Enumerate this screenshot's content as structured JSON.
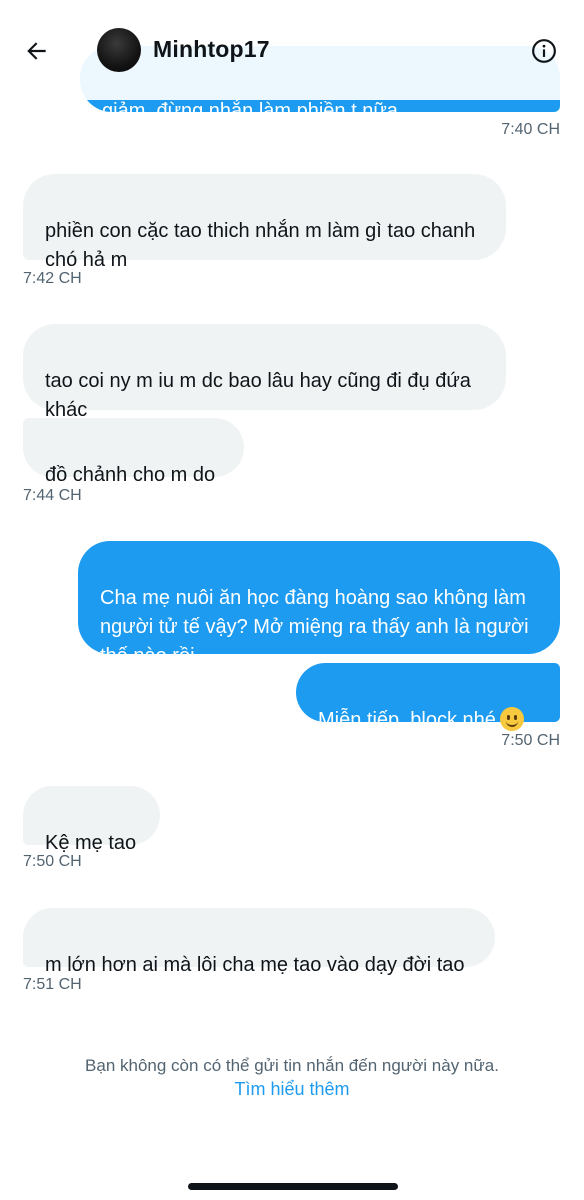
{
  "header": {
    "contact_name": "Minhtop17",
    "back_icon": "arrow-left-icon",
    "info_icon": "info-circle-icon"
  },
  "messages": [
    {
      "from": "me",
      "text": "giảm, đừng nhắn làm phiền t nữa",
      "time": "7:40 CH"
    },
    {
      "from": "them",
      "text": "phiền con cặc tao thich nhắn m làm gì tao chanh chó hả m",
      "time": "7:42 CH"
    },
    {
      "from": "them",
      "text": "tao coi ny m iu m dc bao lâu hay cũng đi đụ đứa khác"
    },
    {
      "from": "them",
      "text": "đồ chảnh cho m do",
      "time": "7:44 CH"
    },
    {
      "from": "me",
      "text": "Cha mẹ nuôi ăn học đàng hoàng sao không làm người tử tế vậy? Mở miệng ra thấy anh là người thế nào rồi"
    },
    {
      "from": "me",
      "text": "Miễn tiếp, block nhé",
      "emoji": "slightly-smiling-face",
      "time": "7:50 CH"
    },
    {
      "from": "them",
      "text": "Kệ mẹ tao",
      "time": "7:50 CH"
    },
    {
      "from": "them",
      "text": "m lớn hơn ai mà lôi cha mẹ tao vào dạy đời tao",
      "time": "7:51 CH"
    }
  ],
  "footer": {
    "notice": "Bạn không còn có thể gửi tin nhắn đến người này nữa.",
    "learn_more": "Tìm hiểu thêm"
  },
  "colors": {
    "outgoing_bubble": "#1d9bf0",
    "incoming_bubble": "#eff3f4",
    "link": "#1d9bf0",
    "muted_text": "#536471"
  }
}
